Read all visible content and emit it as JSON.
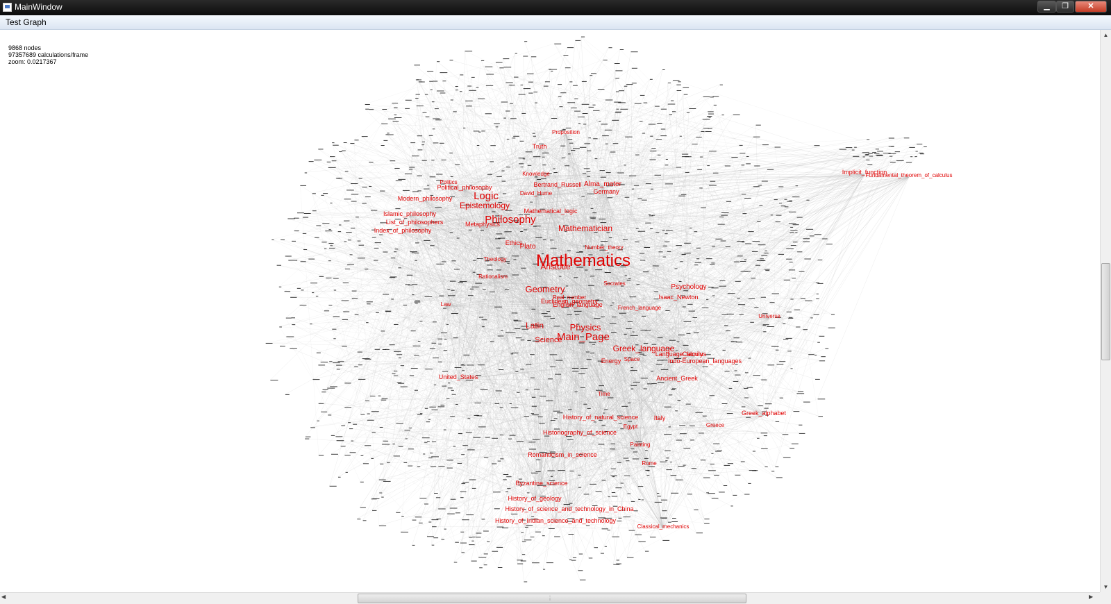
{
  "window": {
    "title": "MainWindow",
    "min_glyph": "▁",
    "max_glyph": "❐",
    "close_glyph": "✕"
  },
  "menu": {
    "items": [
      "Test Graph"
    ]
  },
  "stats": {
    "nodes": "9868 nodes",
    "calculations": "97357689 calculations/frame",
    "zoom": "zoom: 0.0217367"
  },
  "colors": {
    "label": "#e00000",
    "edge": "#b8b8b8",
    "node": "#1a1a1a"
  },
  "graph": {
    "labels": [
      {
        "text": "Mathematics",
        "size": 24
      },
      {
        "text": "Philosophy",
        "size": 15
      },
      {
        "text": "Logic",
        "size": 15
      },
      {
        "text": "Main_Page",
        "size": 15
      },
      {
        "text": "Physics",
        "size": 13
      },
      {
        "text": "Geometry",
        "size": 13
      },
      {
        "text": "Greek_language",
        "size": 12
      },
      {
        "text": "Latin",
        "size": 12
      },
      {
        "text": "Epistemology",
        "size": 12
      },
      {
        "text": "Mathematician",
        "size": 12
      },
      {
        "text": "Science",
        "size": 11
      },
      {
        "text": "Psychology",
        "size": 10
      },
      {
        "text": "Alma_mater",
        "size": 10
      },
      {
        "text": "Bertrand_Russell",
        "size": 9
      },
      {
        "text": "Germany",
        "size": 9
      },
      {
        "text": "Truth",
        "size": 9
      },
      {
        "text": "Proposition",
        "size": 8
      },
      {
        "text": "Political_philosophy",
        "size": 9
      },
      {
        "text": "Mathematical_logic",
        "size": 9
      },
      {
        "text": "Modern_philosophy",
        "size": 9
      },
      {
        "text": "Islamic_philosophy",
        "size": 9
      },
      {
        "text": "List_of_philosophers",
        "size": 9
      },
      {
        "text": "Index_of_philosophy",
        "size": 9
      },
      {
        "text": "Euclidean_geometry",
        "size": 9
      },
      {
        "text": "English_language",
        "size": 9
      },
      {
        "text": "Indo-European_languages",
        "size": 9
      },
      {
        "text": "Language_family",
        "size": 9
      },
      {
        "text": "Ancient_Greek",
        "size": 9
      },
      {
        "text": "Implicit_function",
        "size": 9
      },
      {
        "text": "Fundamental_theorem_of_calculus",
        "size": 8
      },
      {
        "text": "Isaac_Newton",
        "size": 9
      },
      {
        "text": "French_language",
        "size": 8
      },
      {
        "text": "United_States",
        "size": 9
      },
      {
        "text": "History_of_natural_science",
        "size": 9
      },
      {
        "text": "Italy",
        "size": 9
      },
      {
        "text": "Historiography_of_science",
        "size": 9
      },
      {
        "text": "Romanticism_in_science",
        "size": 9
      },
      {
        "text": "Byzantine_science",
        "size": 9
      },
      {
        "text": "History_of_geology",
        "size": 9
      },
      {
        "text": "History_of_science_and_technology_in_China",
        "size": 9
      },
      {
        "text": "History_of_Indian_science_and_technology",
        "size": 9
      },
      {
        "text": "Classical_mechanics",
        "size": 8
      },
      {
        "text": "Greece",
        "size": 8
      },
      {
        "text": "Greek_alphabet",
        "size": 9
      },
      {
        "text": "Painting",
        "size": 8
      },
      {
        "text": "Rome",
        "size": 8
      },
      {
        "text": "Egypt",
        "size": 8
      },
      {
        "text": "Time",
        "size": 8
      },
      {
        "text": "Energy",
        "size": 9
      },
      {
        "text": "Space",
        "size": 8
      },
      {
        "text": "Universe",
        "size": 8
      },
      {
        "text": "Socrates",
        "size": 8
      },
      {
        "text": "Law",
        "size": 8
      },
      {
        "text": "Real_number",
        "size": 8
      },
      {
        "text": "Politics",
        "size": 8
      },
      {
        "text": "Number_theory",
        "size": 8
      },
      {
        "text": "David_Hume",
        "size": 8
      },
      {
        "text": "Knowledge",
        "size": 8
      },
      {
        "text": "Aristotle",
        "size": 12
      },
      {
        "text": "Theology",
        "size": 8
      },
      {
        "text": "Rationalism",
        "size": 8
      },
      {
        "text": "Ethics",
        "size": 9
      },
      {
        "text": "Metaphysics",
        "size": 9
      },
      {
        "text": "Calculus",
        "size": 9
      },
      {
        "text": "Plato",
        "size": 10
      }
    ]
  }
}
